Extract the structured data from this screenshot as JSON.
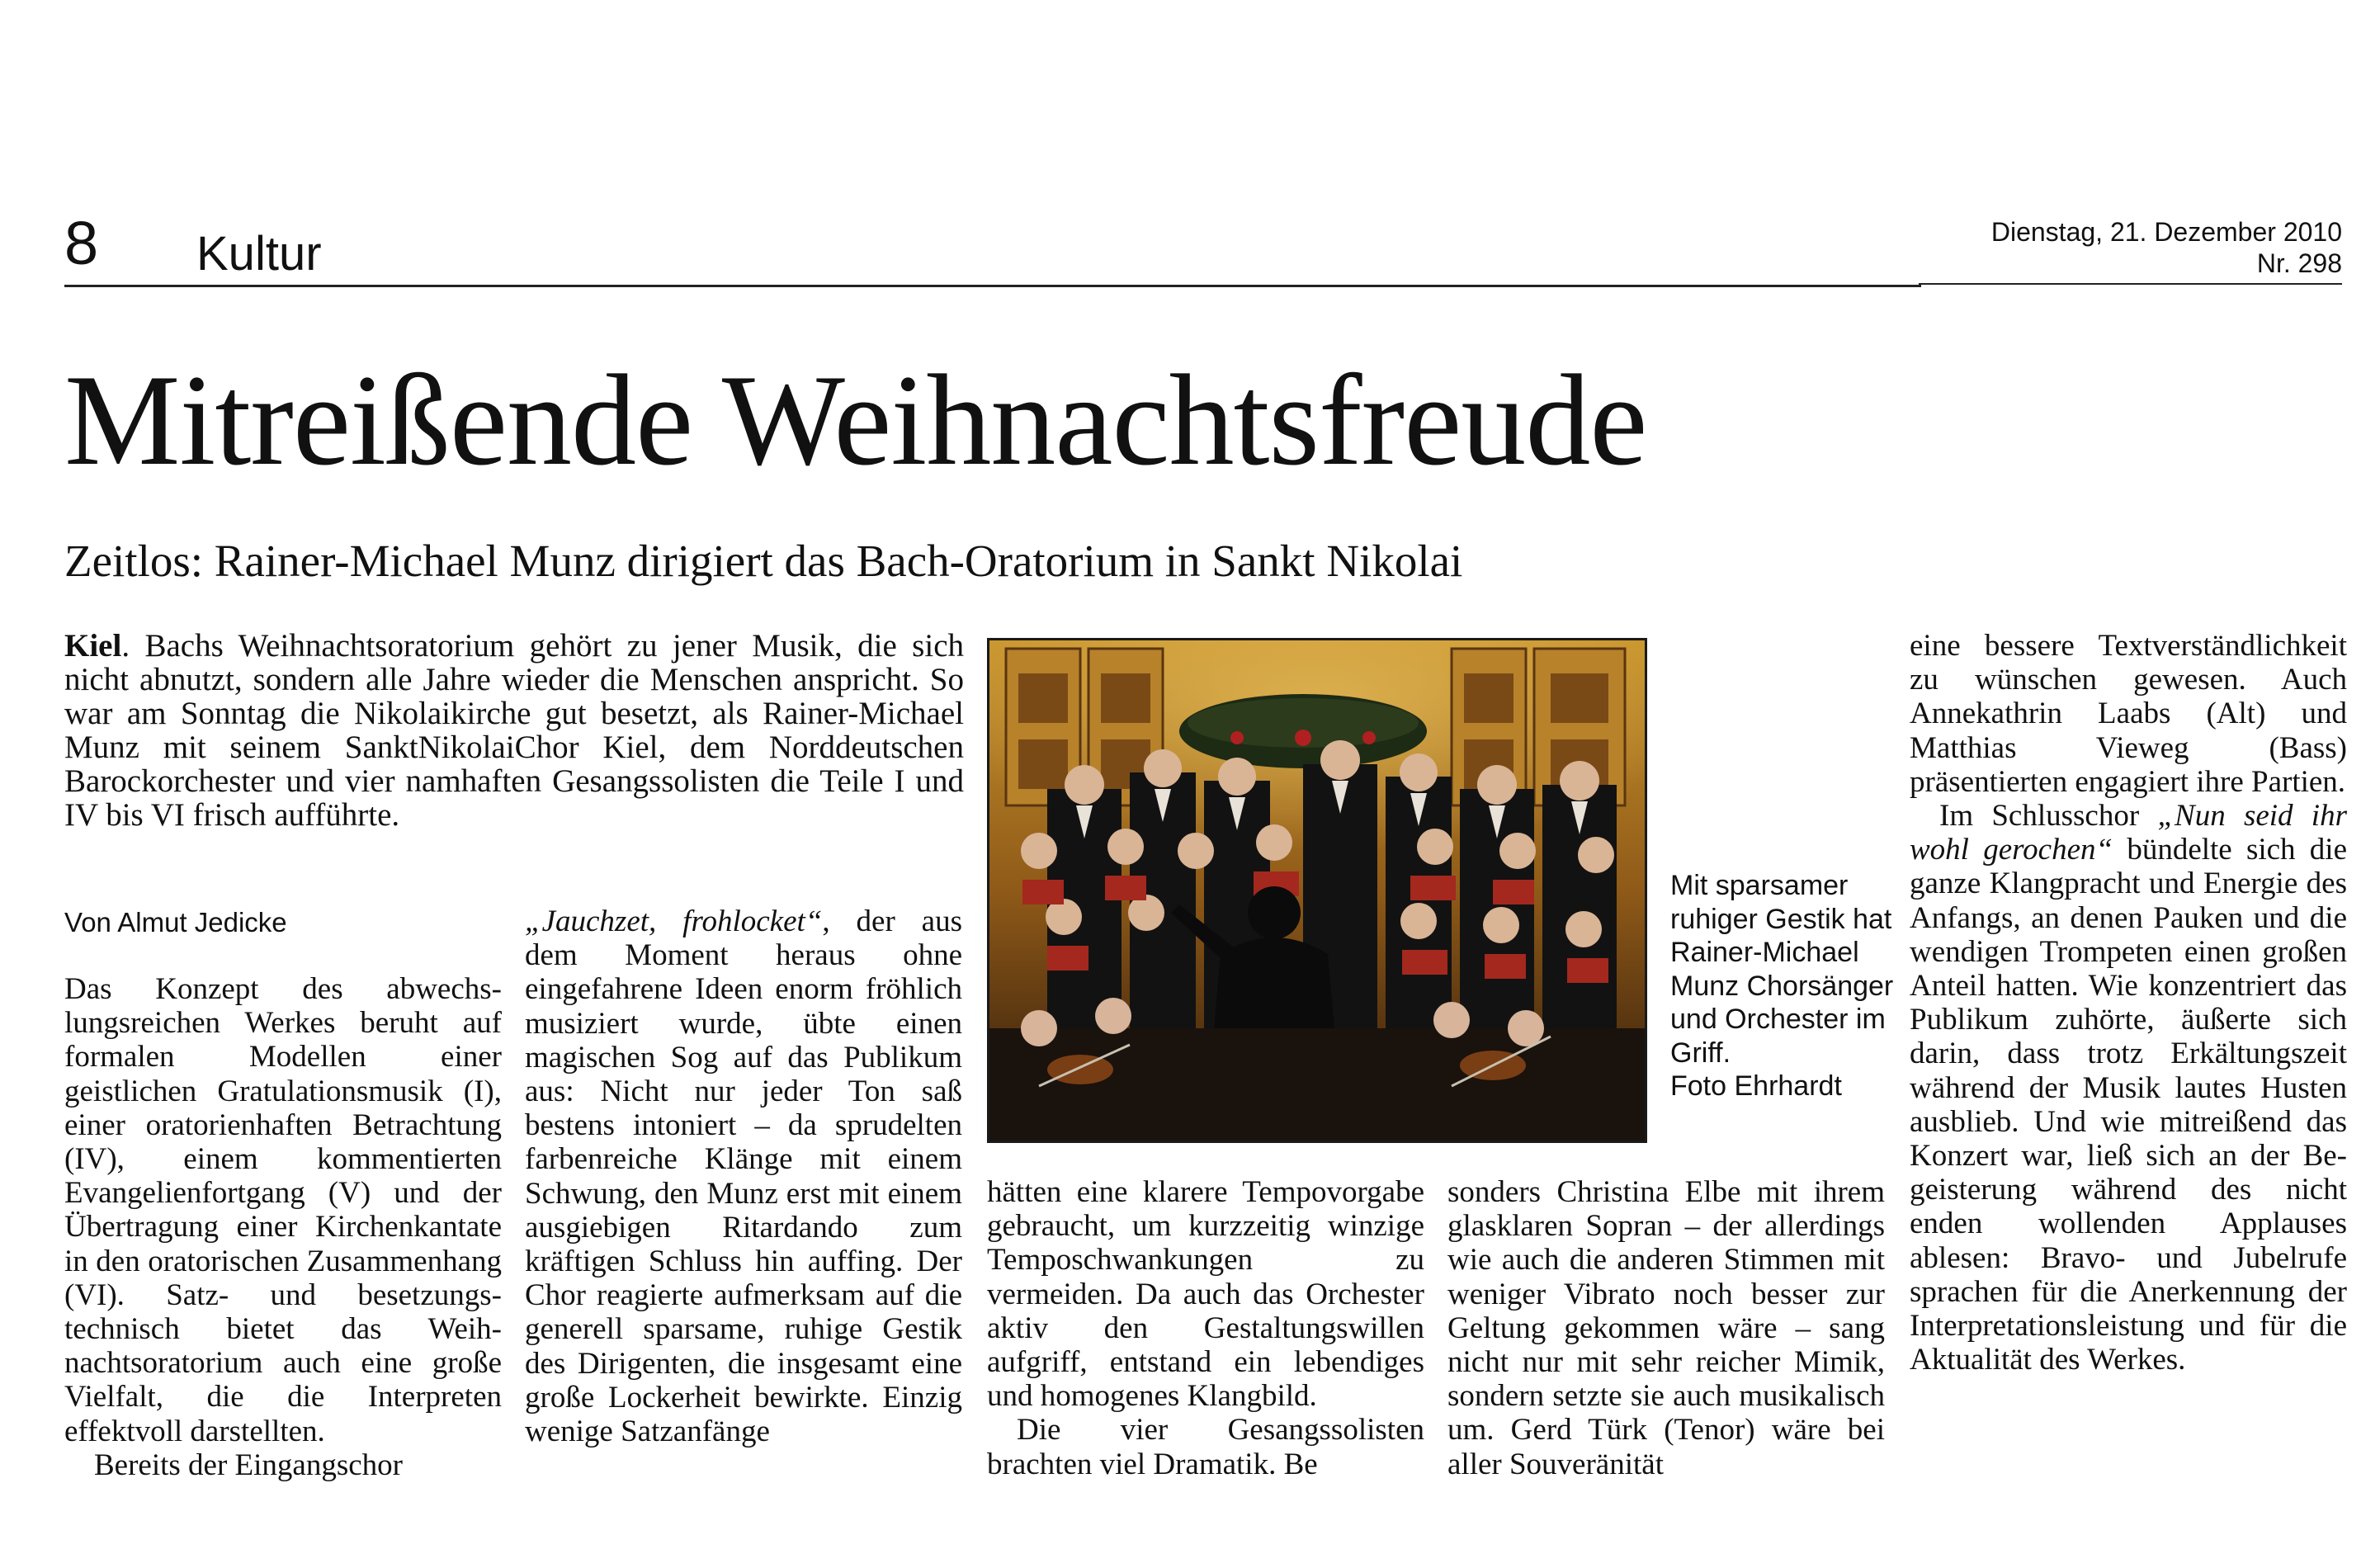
{
  "header": {
    "page_number": "8",
    "section": "Kultur",
    "date": "Dienstag, 21. Dezember 2010",
    "issue": "Nr. 298"
  },
  "article": {
    "headline": "Mitreißende Weihnachtsfreude",
    "subheadline": "Zeitlos: Rainer-Michael Munz dirigiert das Bach-Oratorium in Sankt Nikolai",
    "intro_place": "Kiel",
    "intro_text": ". Bachs Weihnachtsoratorium gehört zu jener Musik, die sich nicht abnutzt, sondern alle Jahre wieder die Menschen anspricht. So war am Sonntag die Nikolaikirche gut besetzt, als Rainer-Michael Munz mit seinem SanktNikolaiChor Kiel, dem Norddeutschen Barockorchester und vier namhaften Gesangssolisten die Teile I und IV bis VI frisch aufführte.",
    "byline": "Von Almut Jedicke",
    "col1_p1": "Das Konzept des abwechs­lungsreichen Werkes beruht auf formalen Modellen einer geistlichen Gratulationsmu­sik (I), einer oratorienhaften Betrachtung (IV), einem kom­mentierten Evangelienfort­gang (V) und der Übertragung einer Kirchenkantate in den oratorischen Zusammenhang (VI). Satz- und besetzungs­technisch bietet das Weih­nachtsoratorium auch eine große Vielfalt, die die Inter­preten effektvoll darstellten.",
    "col1_p2": "Bereits der Eingangschor",
    "col2_quote": "„Jauchzet, frohlocket“",
    "col2_text": ", der aus dem Moment heraus ohne eingefahrene Ideen enorm fröhlich musiziert wurde, üb­te einen magischen Sog auf das Publikum aus: Nicht nur jeder Ton saß bestens into­niert – da sprudelten farben­reiche Klänge mit einem Schwung, den Munz erst mit einem ausgiebigen Ritardan­do zum kräftigen Schluss hin auffing. Der Chor reagierte aufmerksam auf die generell sparsame, ruhige Gestik des Dirigenten, die insgesamt ei­ne große Lockerheit bewirkte. Einzig wenige Satzanfänge",
    "col3_p1": "hätten eine klarere Tempo­vorgabe gebraucht, um kurz­zeitig winzige Temposchwan­kungen zu vermeiden. Da auch das Orchester aktiv den Gestaltungswillen aufgriff, entstand ein lebendiges und homogenes Klangbild.",
    "col3_p2": "Die vier Gesangssolisten brachten viel Dramatik. Be­",
    "col4_p1": "sonders Christina Elbe mit ih­rem glasklaren Sopran – der allerdings wie auch die ande­ren Stimmen mit weniger Vi­brato noch besser zur Geltung gekommen wäre – sang nicht nur mit sehr reicher Mimik, sondern setzte sie auch musi­kalisch um. Gerd Türk (Tenor) wäre bei aller Souveränität",
    "col5_p1": "eine bessere Textverständ­lichkeit zu wünschen gewe­sen. Auch Annekathrin Laabs (Alt) und Matthias Vieweg (Bass) präsentierten engagiert ihre Partien.",
    "col5_p2_lead": "Im Schlusschor ",
    "col5_p2_quote": "„Nun seid ihr wohl gerochen“",
    "col5_p2_text": " bündelte sich die ganze Klangpracht und Energie des Anfangs, an denen Pauken und die wendi­gen Trompeten einen großen Anteil hatten. Wie konzen­triert das Publikum zuhörte, äußerte sich darin, dass trotz Erkältungszeit während der Musik lautes Husten ausblieb. Und wie mitreißend das Kon­zert war, ließ sich an der Be­geisterung während des nicht enden wollenden Applauses ablesen: Bravo- und Jubelrufe sprachen für die Anerken­nung der Interpretationsleis­tung und für die Aktualität des Werkes."
  },
  "photo": {
    "caption": "Mit sparsamer ruhiger Gestik hat Rainer-Michael Munz Chorsänger und Orchester im Griff.",
    "credit": "Foto Ehrhardt"
  },
  "colors": {
    "ink": "#1a1a1a",
    "paper": "#ffffff",
    "ghost": "#ebebeb"
  }
}
